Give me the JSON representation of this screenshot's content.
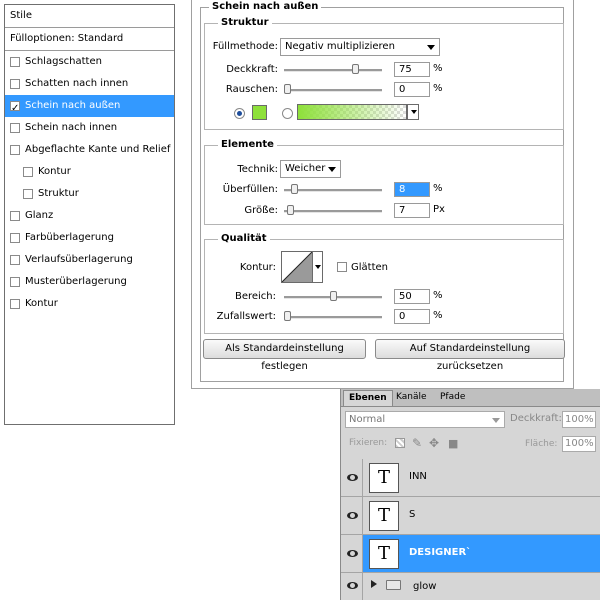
{
  "style_list": {
    "header": "Stile",
    "blending_options": "Fülloptionen: Standard",
    "items": [
      {
        "label": "Schlagschatten",
        "checked": false
      },
      {
        "label": "Schatten nach innen",
        "checked": false
      },
      {
        "label": "Schein nach außen",
        "checked": true,
        "selected": true
      },
      {
        "label": "Schein nach innen",
        "checked": false
      },
      {
        "label": "Abgeflachte Kante und Relief",
        "checked": false
      },
      {
        "label": "Kontur",
        "checked": false,
        "sub": true
      },
      {
        "label": "Struktur",
        "checked": false,
        "sub": true
      },
      {
        "label": "Glanz",
        "checked": false
      },
      {
        "label": "Farbüberlagerung",
        "checked": false
      },
      {
        "label": "Verlaufsüberlagerung",
        "checked": false
      },
      {
        "label": "Musterüberlagerung",
        "checked": false
      },
      {
        "label": "Kontur",
        "checked": false
      }
    ]
  },
  "dialog": {
    "title": "Schein nach außen",
    "structure": {
      "title": "Struktur",
      "blend_mode_label": "Füllmethode:",
      "blend_mode": "Negativ multiplizieren",
      "opacity_label": "Deckkraft:",
      "opacity": "75",
      "opacity_level": 0.75,
      "noise_label": "Rauschen:",
      "noise": "0",
      "noise_level": 0,
      "percent": "%",
      "color": "#8ee03a"
    },
    "elements": {
      "title": "Elemente",
      "technique_label": "Technik:",
      "technique": "Weicher",
      "spread_label": "Überfüllen:",
      "spread": "8",
      "spread_level": 0.08,
      "size_label": "Größe:",
      "size": "7",
      "size_level": 0.03,
      "percent": "%",
      "px": "Px"
    },
    "quality": {
      "title": "Qualität",
      "contour_label": "Kontur:",
      "antialias_label": "Glätten",
      "range_label": "Bereich:",
      "range": "50",
      "range_level": 0.5,
      "jitter_label": "Zufallswert:",
      "jitter": "0",
      "jitter_level": 0,
      "percent": "%"
    },
    "set_default": "Als Standardeinstellung festlegen",
    "reset_default": "Auf Standardeinstellung zurücksetzen"
  },
  "layers": {
    "tabs": [
      "Ebenen",
      "Kanäle",
      "Pfade"
    ],
    "blend_mode": "Normal",
    "opacity_label": "Deckkraft:",
    "opacity": "100%",
    "lock_label": "Fixieren:",
    "fill_label": "Fläche:",
    "fill": "100%",
    "items": [
      {
        "name": "INN",
        "type": "text",
        "selected": false
      },
      {
        "name": "S",
        "type": "text",
        "selected": false
      },
      {
        "name": "DESIGNER`",
        "type": "text",
        "selected": true
      },
      {
        "name": "glow",
        "type": "group",
        "selected": false
      }
    ]
  }
}
